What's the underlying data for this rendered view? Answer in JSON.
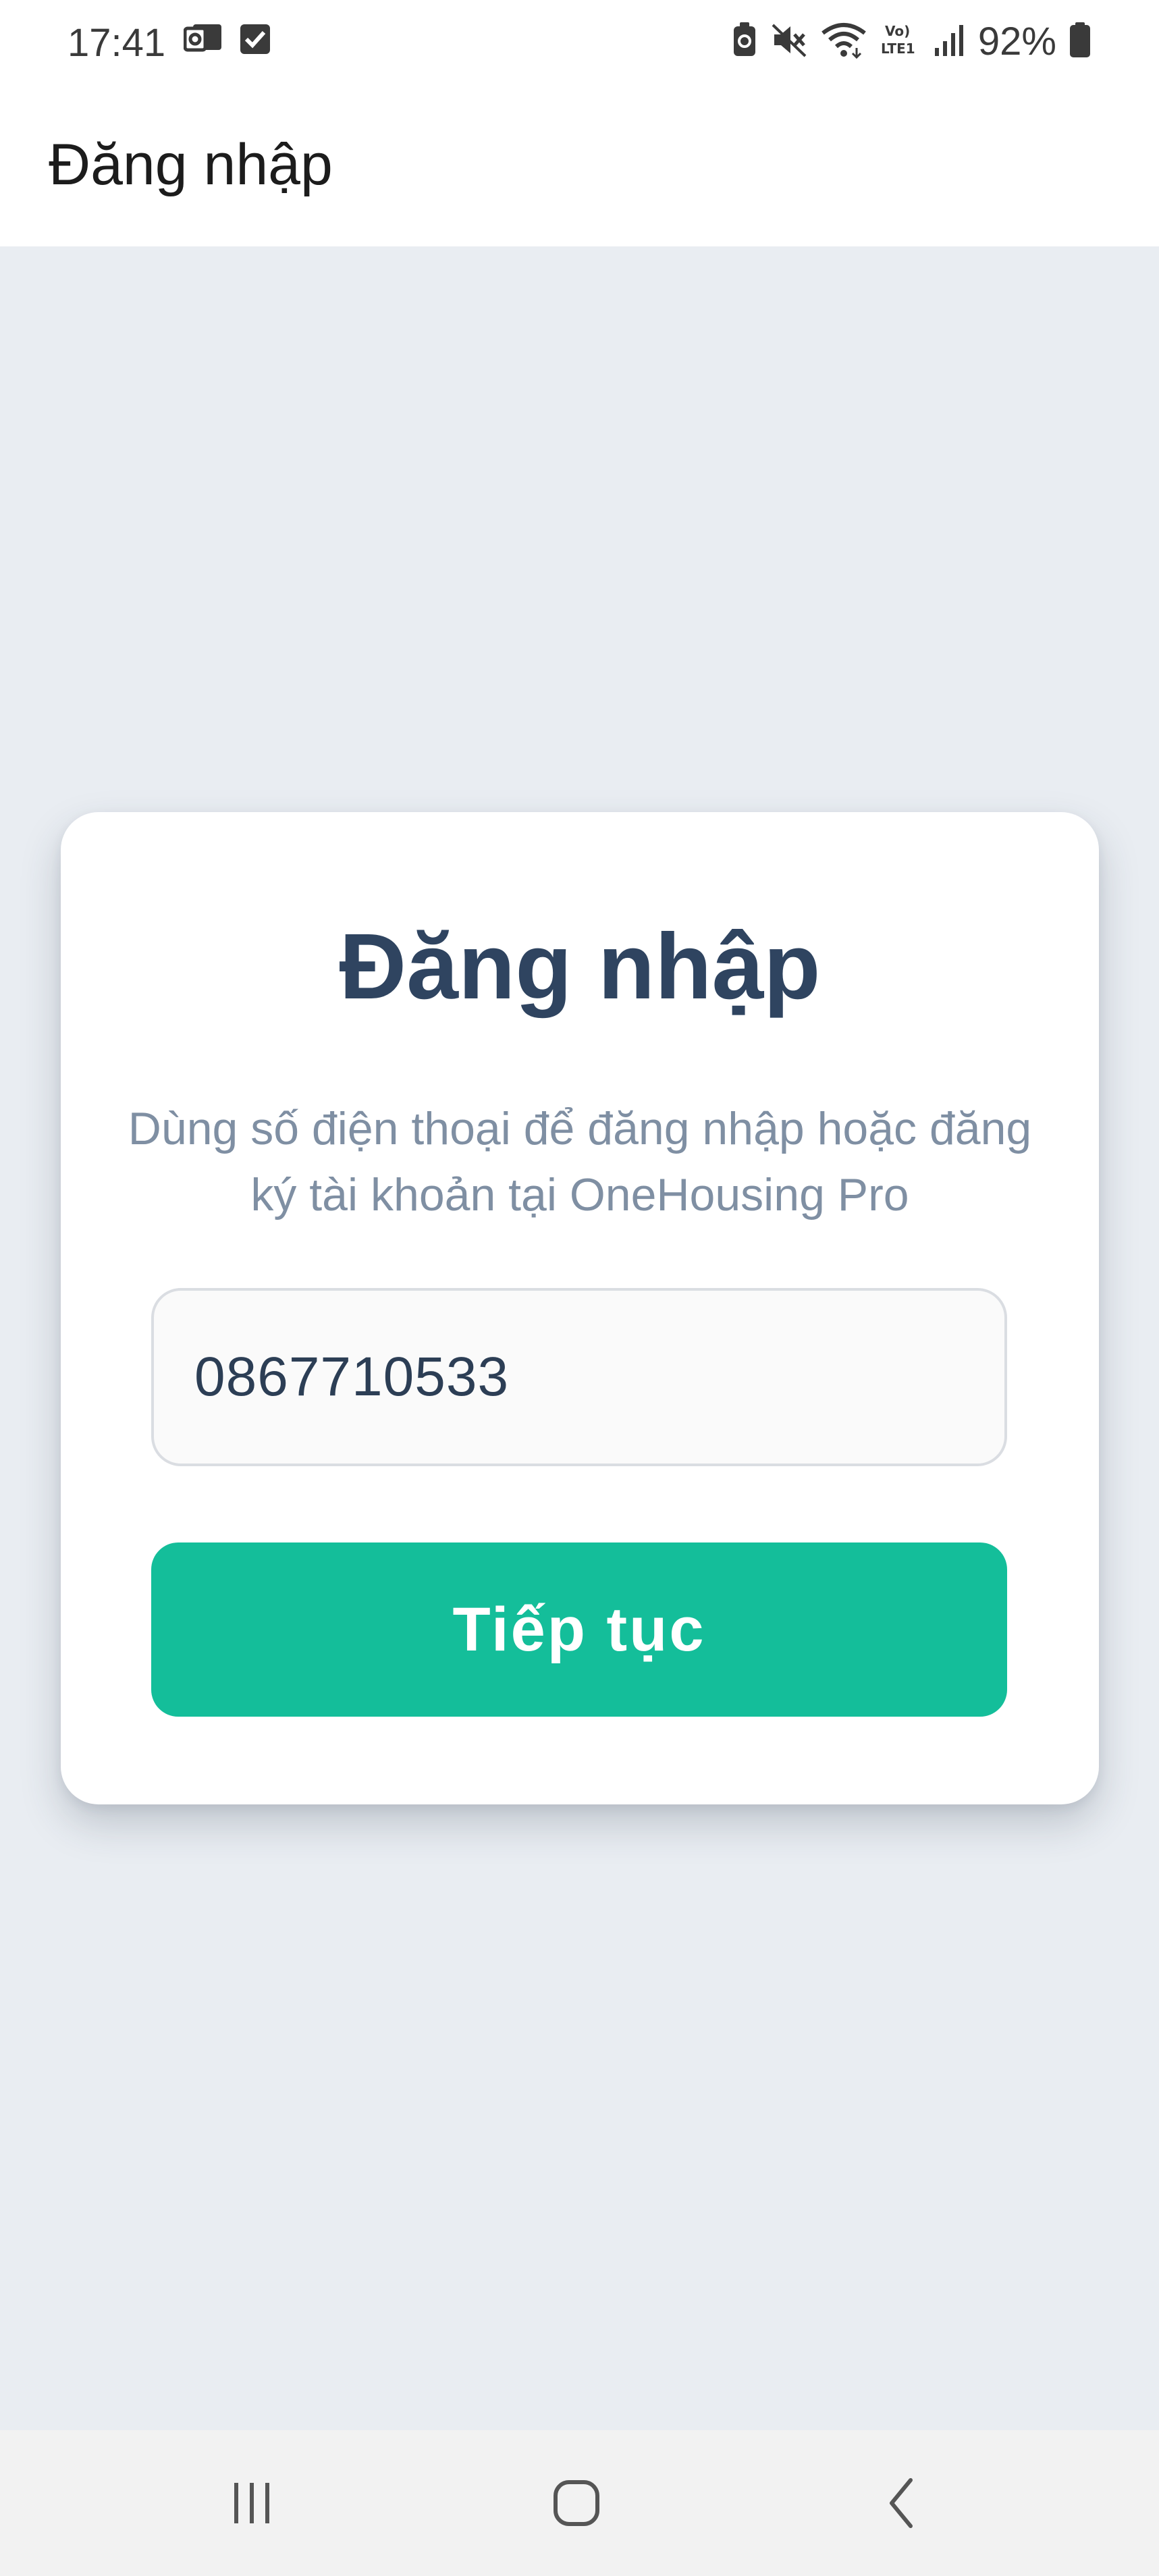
{
  "status_bar": {
    "time": "17:41",
    "left_icons": [
      "outlook-icon",
      "checkbox-icon"
    ],
    "right_icons": [
      "battery-saver-icon",
      "mute-icon",
      "wifi-icon",
      "volte-icon",
      "signal-icon"
    ],
    "battery": "92%"
  },
  "app_bar": {
    "title": "Đăng nhập"
  },
  "login_card": {
    "title": "Đăng nhập",
    "subtitle": "Dùng số điện thoại để đăng nhập hoặc đăng ký tài khoản tại OneHousing Pro",
    "phone_value": "0867710533",
    "continue_label": "Tiếp tục"
  },
  "colors": {
    "accent": "#14be9a",
    "title": "#2f4460",
    "background": "#e9edf2"
  },
  "nav_bar": {
    "buttons": [
      "recent-apps-icon",
      "home-icon",
      "back-icon"
    ]
  }
}
